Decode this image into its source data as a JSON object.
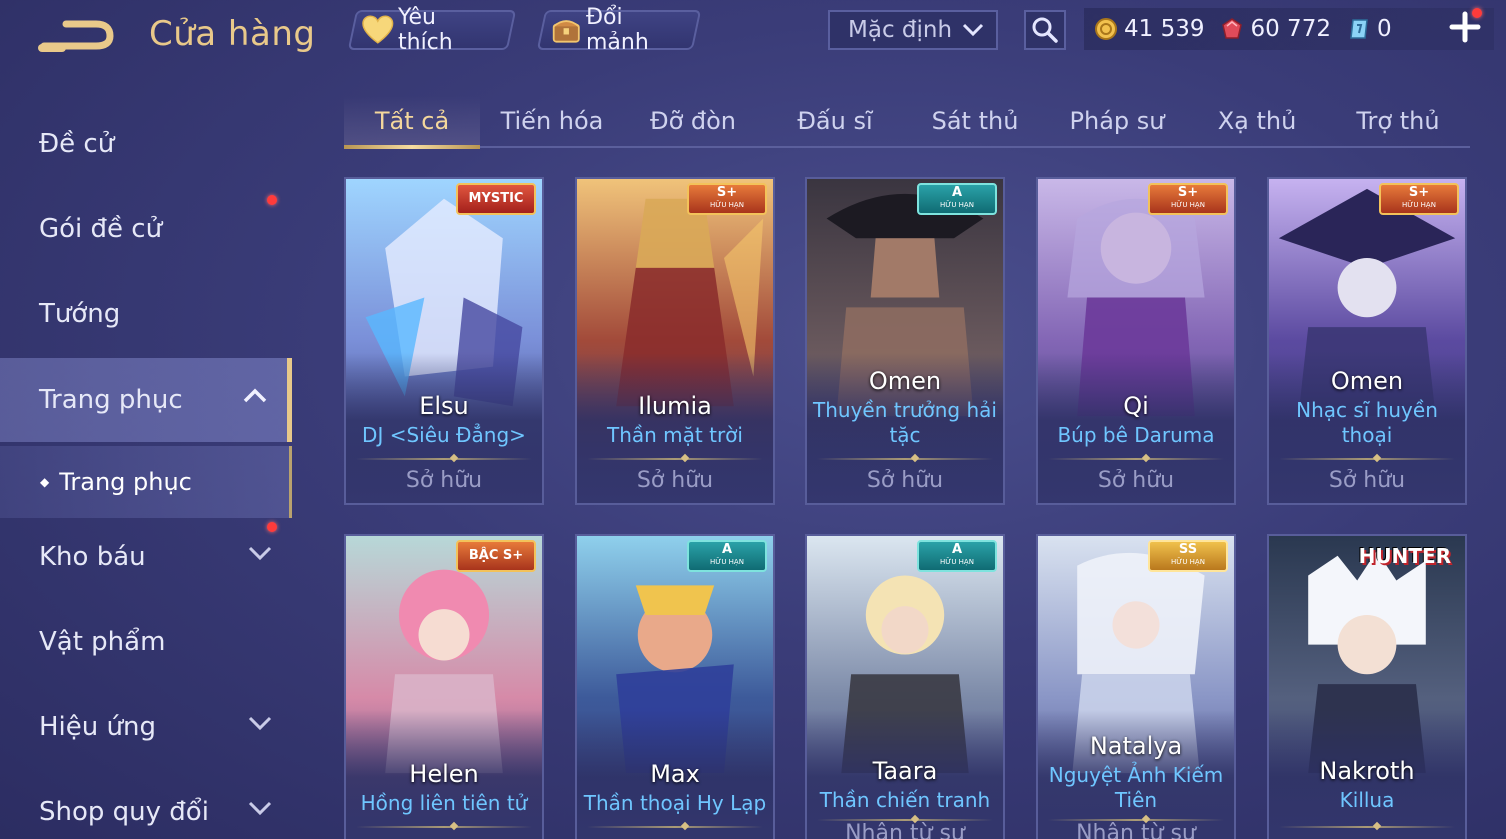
{
  "header": {
    "title": "Cửa hàng",
    "favorite_label": "Yêu thích",
    "exchange_label": "Đổi mảnh",
    "sort_value": "Mặc định",
    "currencies": [
      {
        "icon": "gold-coin-icon",
        "value": "41 539"
      },
      {
        "icon": "ruby-gem-icon",
        "value": "60 772"
      },
      {
        "icon": "voucher-icon",
        "value": "0"
      }
    ]
  },
  "sidebar": {
    "items": [
      {
        "label": "Đề cử"
      },
      {
        "label": "Gói đề cử"
      },
      {
        "label": "Tướng"
      },
      {
        "label": "Trang phục"
      },
      {
        "label": "Kho báu"
      },
      {
        "label": "Vật phẩm"
      },
      {
        "label": "Hiệu ứng"
      },
      {
        "label": "Shop quy đổi"
      }
    ],
    "sub_item": "Trang phục"
  },
  "tabs": [
    "Tất cả",
    "Tiến hóa",
    "Đỡ đòn",
    "Đấu sĩ",
    "Sát thủ",
    "Pháp sư",
    "Xạ thủ",
    "Trợ thủ"
  ],
  "cards": [
    {
      "hero": "Elsu",
      "skin": "DJ <Siêu Đẳng>",
      "status": "Sở hữu",
      "badge": "MYSTIC",
      "badge_sub": ""
    },
    {
      "hero": "Ilumia",
      "skin": "Thần mặt trời",
      "status": "Sở hữu",
      "badge": "S+",
      "badge_sub": "HỮU HẠN"
    },
    {
      "hero": "Omen",
      "skin": "Thuyền trưởng hải tặc",
      "status": "Sở hữu",
      "badge": "A",
      "badge_sub": "HỮU HẠN"
    },
    {
      "hero": "Qi",
      "skin": "Búp bê Daruma",
      "status": "Sở hữu",
      "badge": "S+",
      "badge_sub": "HỮU HẠN"
    },
    {
      "hero": "Omen",
      "skin": "Nhạc sĩ huyền thoại",
      "status": "Sở hữu",
      "badge": "S+",
      "badge_sub": "HỮU HẠN"
    },
    {
      "hero": "Helen",
      "skin": "Hồng liên tiên tử",
      "status": "",
      "badge": "BẬC S+",
      "badge_sub": ""
    },
    {
      "hero": "Max",
      "skin": "Thần thoại Hy Lạp",
      "status": "",
      "badge": "A",
      "badge_sub": "HỮU HẠN"
    },
    {
      "hero": "Taara",
      "skin": "Thần chiến tranh",
      "status": "Nhận từ sự",
      "badge": "A",
      "badge_sub": "HỮU HẠN"
    },
    {
      "hero": "Natalya",
      "skin": "Nguyệt Ảnh Kiếm Tiên",
      "status": "Nhận từ sự",
      "badge": "SS",
      "badge_sub": "HỮU HẠN"
    },
    {
      "hero": "Nakroth",
      "skin": "Killua",
      "status": "",
      "badge": "HUNTER",
      "badge_sub": ""
    }
  ]
}
